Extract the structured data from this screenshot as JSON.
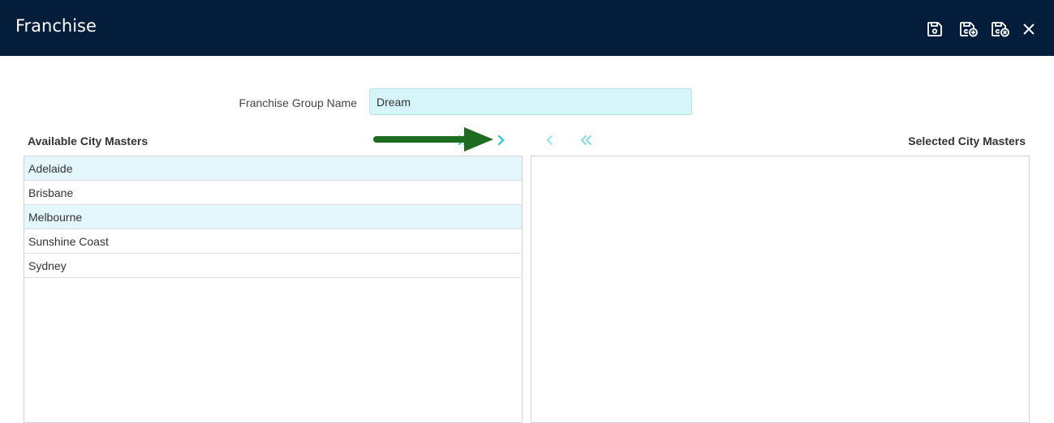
{
  "header": {
    "title": "Franchise",
    "icons": [
      "save-icon",
      "save-and-new-icon",
      "save-and-close-icon",
      "close-icon"
    ]
  },
  "form": {
    "franchise_group_name_label": "Franchise Group Name",
    "franchise_group_name_value": "Dream"
  },
  "available": {
    "heading": "Available City Masters",
    "items": [
      "Adelaide",
      "Brisbane",
      "Melbourne",
      "Sunshine Coast",
      "Sydney"
    ]
  },
  "selected": {
    "heading": "Selected City Masters",
    "items": []
  },
  "transfer_controls": [
    "move-all-right-icon",
    "move-right-icon",
    "move-left-icon",
    "move-all-left-icon"
  ],
  "colors": {
    "header_bg": "#041d3b",
    "accent": "#25c6d1",
    "input_bg": "#d5f5fb",
    "row_alt_bg": "#e3f7fc",
    "annotation_arrow": "#1e6b22"
  }
}
